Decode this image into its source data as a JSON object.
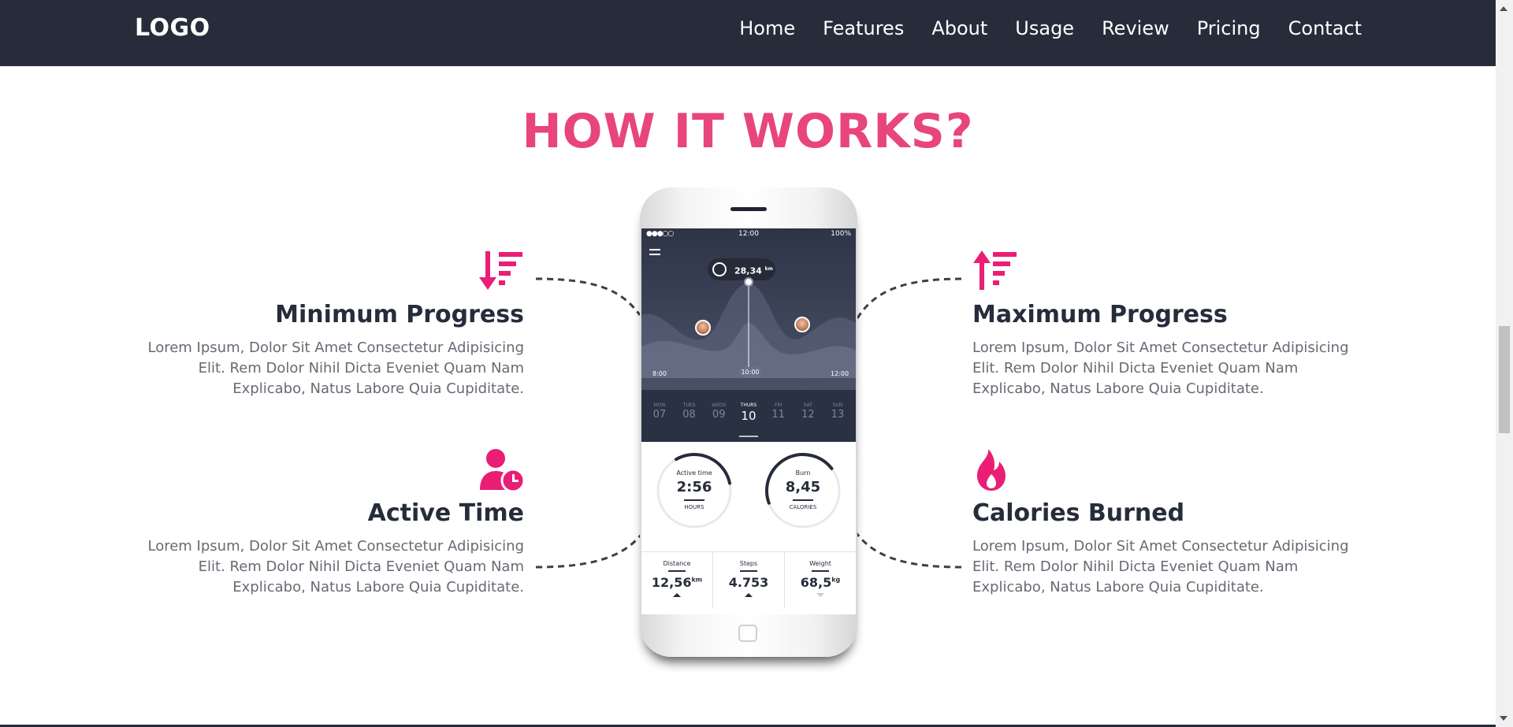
{
  "navbar": {
    "logo": "LOGO",
    "links": [
      "Home",
      "Features",
      "About",
      "Usage",
      "Review",
      "Pricing",
      "Contact"
    ]
  },
  "section": {
    "title": "HOW IT WORKS?"
  },
  "features": [
    {
      "title": "Minimum Progress",
      "icon": "sort-amount-down-icon",
      "text": "Lorem Ipsum, Dolor Sit Amet Consectetur Adipisicing Elit. Rem Dolor Nihil Dicta Eveniet Quam Nam Explicabo, Natus Labore Quia Cupiditate."
    },
    {
      "title": "Maximum Progress",
      "icon": "sort-amount-up-icon",
      "text": "Lorem Ipsum, Dolor Sit Amet Consectetur Adipisicing Elit. Rem Dolor Nihil Dicta Eveniet Quam Nam Explicabo, Natus Labore Quia Cupiditate."
    },
    {
      "title": "Active Time",
      "icon": "user-clock-icon",
      "text": "Lorem Ipsum, Dolor Sit Amet Consectetur Adipisicing Elit. Rem Dolor Nihil Dicta Eveniet Quam Nam Explicabo, Natus Labore Quia Cupiditate."
    },
    {
      "title": "Calories Burned",
      "icon": "fire-icon",
      "text": "Lorem Ipsum, Dolor Sit Amet Consectetur Adipisicing Elit. Rem Dolor Nihil Dicta Eveniet Quam Nam Explicabo, Natus Labore Quia Cupiditate."
    }
  ],
  "phone": {
    "status_time": "12:00",
    "status_battery": "100%",
    "pill_value": "28,34",
    "pill_unit": "km",
    "time_start": "8:00",
    "time_now": "10:00",
    "time_end": "12:00",
    "days": [
      {
        "name": "MON",
        "date": "07"
      },
      {
        "name": "TUES",
        "date": "08"
      },
      {
        "name": "WEDS",
        "date": "09"
      },
      {
        "name": "THURS",
        "date": "10"
      },
      {
        "name": "FRI",
        "date": "11"
      },
      {
        "name": "SAT",
        "date": "12"
      },
      {
        "name": "SUN",
        "date": "13"
      }
    ],
    "active_day_index": 3,
    "gauges": [
      {
        "label": "Active time",
        "value": "2:56",
        "unit": "HOURS",
        "fill": 0.3
      },
      {
        "label": "Burn",
        "value": "8,45",
        "unit": "CALORIES",
        "fill": 0.45
      }
    ],
    "stats": [
      {
        "label": "Distance",
        "value": "12,56",
        "unit": "km",
        "trend": "up"
      },
      {
        "label": "Steps",
        "value": "4.753",
        "unit": "",
        "trend": "up"
      },
      {
        "label": "Weight",
        "value": "68,5",
        "unit": "kg",
        "trend": "down"
      }
    ]
  },
  "colors": {
    "accent": "#e8457c",
    "icon_pink": "#e91e74",
    "navbar_bg": "#262c3a",
    "text_dark": "#262c3a",
    "text_body": "#666a73"
  }
}
